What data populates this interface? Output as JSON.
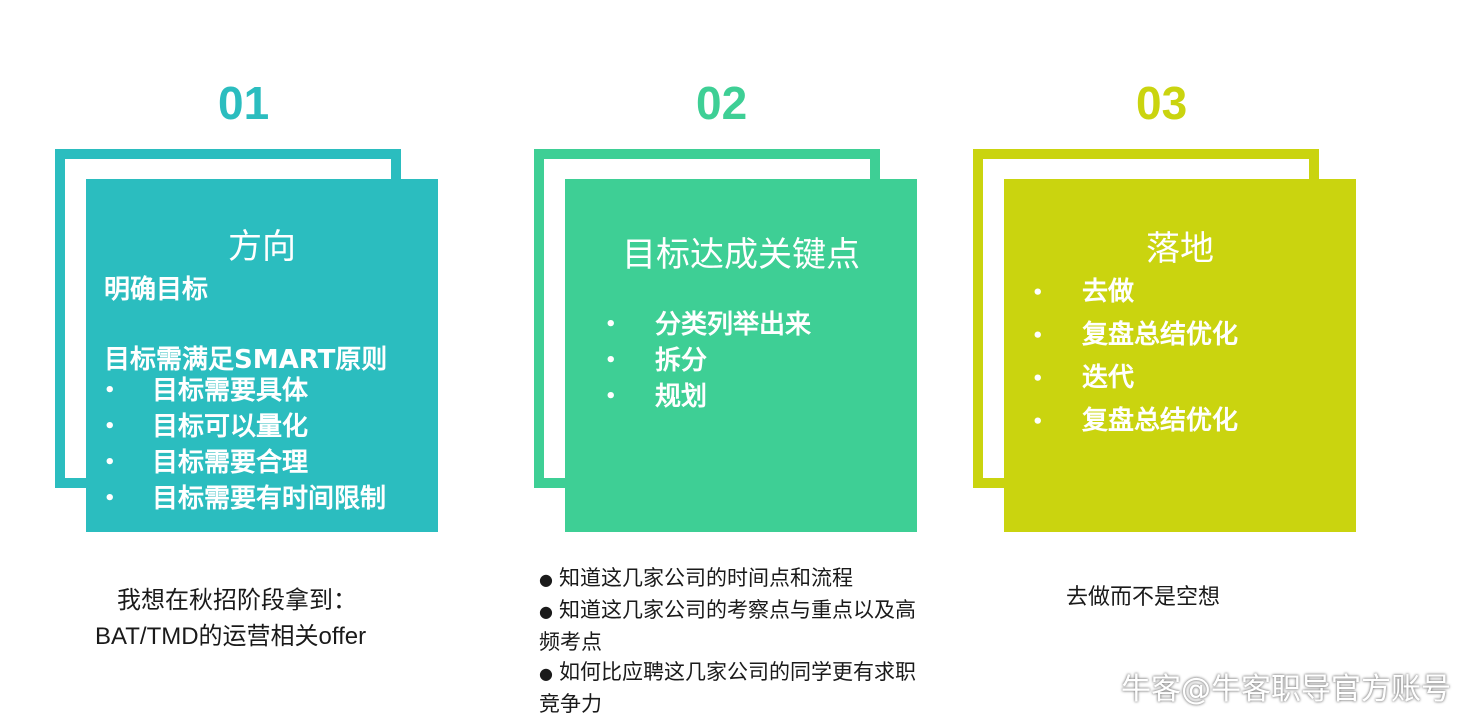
{
  "columns": [
    {
      "number": "01",
      "color": "#2bbdbf",
      "title": "方向",
      "lines": [
        "明确目标",
        "目标需满足SMART原则"
      ],
      "bullets": [
        "目标需要具体",
        "目标可以量化",
        "目标需要合理",
        "目标需要有时间限制"
      ],
      "note_lines": [
        "我想在秋招阶段拿到：",
        "BAT/TMD的运营相关offer"
      ]
    },
    {
      "number": "02",
      "color": "#3ecf95",
      "title": "目标达成关键点",
      "bullets": [
        "分类列举出来",
        "拆分",
        "规划"
      ],
      "notes": [
        "知道这几家公司的时间点和流程",
        "知道这几家公司的考察点与重点以及高频考点",
        "如何比应聘这几家公司的同学更有求职竞争力"
      ]
    },
    {
      "number": "03",
      "color": "#cad40f",
      "title": "落地",
      "bullets": [
        "去做",
        "复盘总结优化",
        "迭代",
        "复盘总结优化"
      ],
      "note": "去做而不是空想"
    }
  ],
  "watermark": "牛客@牛客职导官方账号"
}
